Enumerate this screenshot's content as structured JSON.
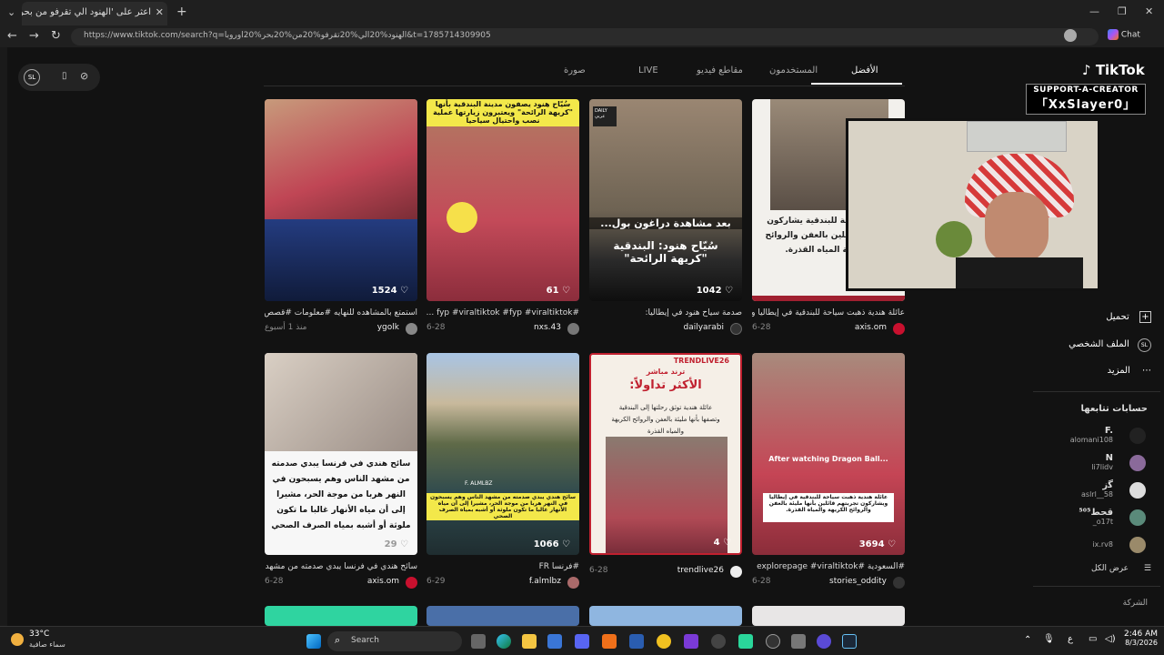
{
  "browser": {
    "tab_title": "اعثر على 'الهنود الي تقرفو من بحر ا",
    "tab_close": "✕",
    "new_tab": "+",
    "url": "https://www.tiktok.com/search?q=الهنود%20الي%20تقرفو%20من%20بحر%20اوروبا&t=1785714309905",
    "copilot_label": "Chat"
  },
  "tiktok": {
    "logo": "TikTok",
    "tabs": [
      "الأفضل",
      "المستخدمون",
      "مقاطع فيديو",
      "LIVE",
      "صورة"
    ],
    "active_tab": "الأفضل"
  },
  "creator_banner": {
    "line1": "SUPPORT-A-CREATOR",
    "line2": "「XxSlayer0」"
  },
  "videos_row1": [
    {
      "likes": "1524",
      "caption": "استمتع بالمشاهده للنهايه #معلومات #قصص_واقعية ...",
      "user": "ygolk",
      "date": "منذ 1 أسبوع"
    },
    {
      "likes": "61",
      "caption": "#fyp #viraltiktok #fyp #viraltiktok ...",
      "user": "nxs.43",
      "date": "6-28",
      "overlay": "سُيّاح هنود يصفون مدينة البندقية بأنها \"كريهة الرائحة\" ويعتبرون زيارتها عملية نصب واحتيال سياحيا"
    },
    {
      "likes": "1042",
      "caption": "صدمة سياح هنود في إيطاليا:",
      "user": "dailyarabi",
      "date": "",
      "overlay_top": "بعد مشاهدة دراغون بول...",
      "overlay_main": "سُيّاح هنود: البندقية \"كريهة الرائحة\"",
      "badge": "DAILY عربي"
    },
    {
      "likes": "",
      "caption": "عائلة هندية ذهبت سياحة للبندقية في إيطاليا ويشا...",
      "user": "axis.om",
      "date": "6-28",
      "overlay": "ذهبت سياحة للبندقية يشاركون تجربتهم قائلين بالعفن والروائح الكريهة المياه القذرة."
    }
  ],
  "videos_row2": [
    {
      "likes": "29",
      "caption": "سائح هندي في فرنسا يبدي صدمته من مشهد الناس...",
      "user": "axis.om",
      "date": "6-28",
      "overlay": "سائح هندي في فرنسا يبدي صدمته من مشهد الناس وهم يسبحون في النهر هربا من موجة الحر، مشيرا إلى أن مياه الأنهار غالبا ما تكون ملوثة أو أشبه بمياه الصرف الصحي"
    },
    {
      "likes": "1066",
      "caption": "#فرنسا FR",
      "user": "f.almlbz",
      "date": "6-29",
      "overlay": "سائح هندي يبدي صدمته من مشهد الناس وهم يسبحون في النهر هربا من موجة الحر، مشيرا إلى أن مياه الأنهار غالبا ما تكون ملوثة أو أشبه بمياه الصرف الصحي",
      "chip": "F. ALMLBZ"
    },
    {
      "likes": "4",
      "caption": "",
      "user": "trendlive26",
      "date": "6-28",
      "overlay_brand": "TRENDLIVE26",
      "overlay_sub": "ترند مباشر",
      "overlay_title": "الأكثر تداولاً:",
      "overlay_body": "عائلة هندية توثق رحلتها إلى البندقية وتصفها بأنها مليئة بالعفن والروائح الكريهة والمياه القذرة"
    },
    {
      "likes": "3694",
      "caption": "#السعودية #explorepage #viraltiktok",
      "user": "stories_oddity",
      "date": "6-28",
      "overlay_en": "After watching Dragon Ball...",
      "overlay": "عائلة هندية ذهبت سياحة للبندقية في إيطاليا ويشاركون تجربتهم قائلين بأنها مليئة بالعفن والروائح الكريهة والمياه القذرة."
    }
  ],
  "sidebar": {
    "items": [
      "تحميل",
      "الملف الشخصي",
      "المزيد"
    ],
    "following_title": "حسابات تتابعها",
    "accounts": [
      {
        "name": "F.",
        "handle": "alomani108"
      },
      {
        "name": "N",
        "handle": "li7lidv"
      },
      {
        "name": "ﮔز",
        "handle": "aslrl__58"
      },
      {
        "name": "قحط⁵⁰⁵",
        "handle": "_o17t"
      },
      {
        "name": "",
        "handle": "ix.rv8"
      }
    ],
    "see_all": "عرض الكل",
    "company": "الشركة"
  },
  "taskbar": {
    "weather_temp": "33°C",
    "weather_desc": "سماء صافية",
    "search_label": "Search",
    "time": "2:46 AM",
    "date": "8/3/2026",
    "lang": "ع"
  },
  "colors": {
    "accent": "#fe2c55",
    "page_bg": "#121212",
    "chrome_bg": "#1f1f1f",
    "yellow_label": "#f3e84a"
  }
}
